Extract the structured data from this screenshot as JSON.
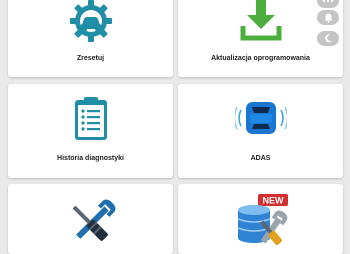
{
  "tiles": [
    {
      "id": "reset",
      "label": "Zresetuj",
      "icon": "gear-car-icon"
    },
    {
      "id": "update",
      "label": "Aktualizacja oprogramowania",
      "icon": "download-icon"
    },
    {
      "id": "history",
      "label": "Historia diagnostyki",
      "icon": "clipboard-list-icon"
    },
    {
      "id": "adas",
      "label": "ADAS",
      "icon": "car-sensor-icon"
    },
    {
      "id": "tools",
      "label": "",
      "icon": "wrench-screwdriver-icon"
    },
    {
      "id": "database",
      "label": "",
      "icon": "database-wrench-icon",
      "badge": "NEW"
    }
  ],
  "side_buttons": [
    "dots-icon",
    "bell-icon",
    "moon-icon"
  ],
  "colors": {
    "teal": "#1f8ea6",
    "green": "#4caf3d",
    "badge_red": "#d32f2f"
  }
}
